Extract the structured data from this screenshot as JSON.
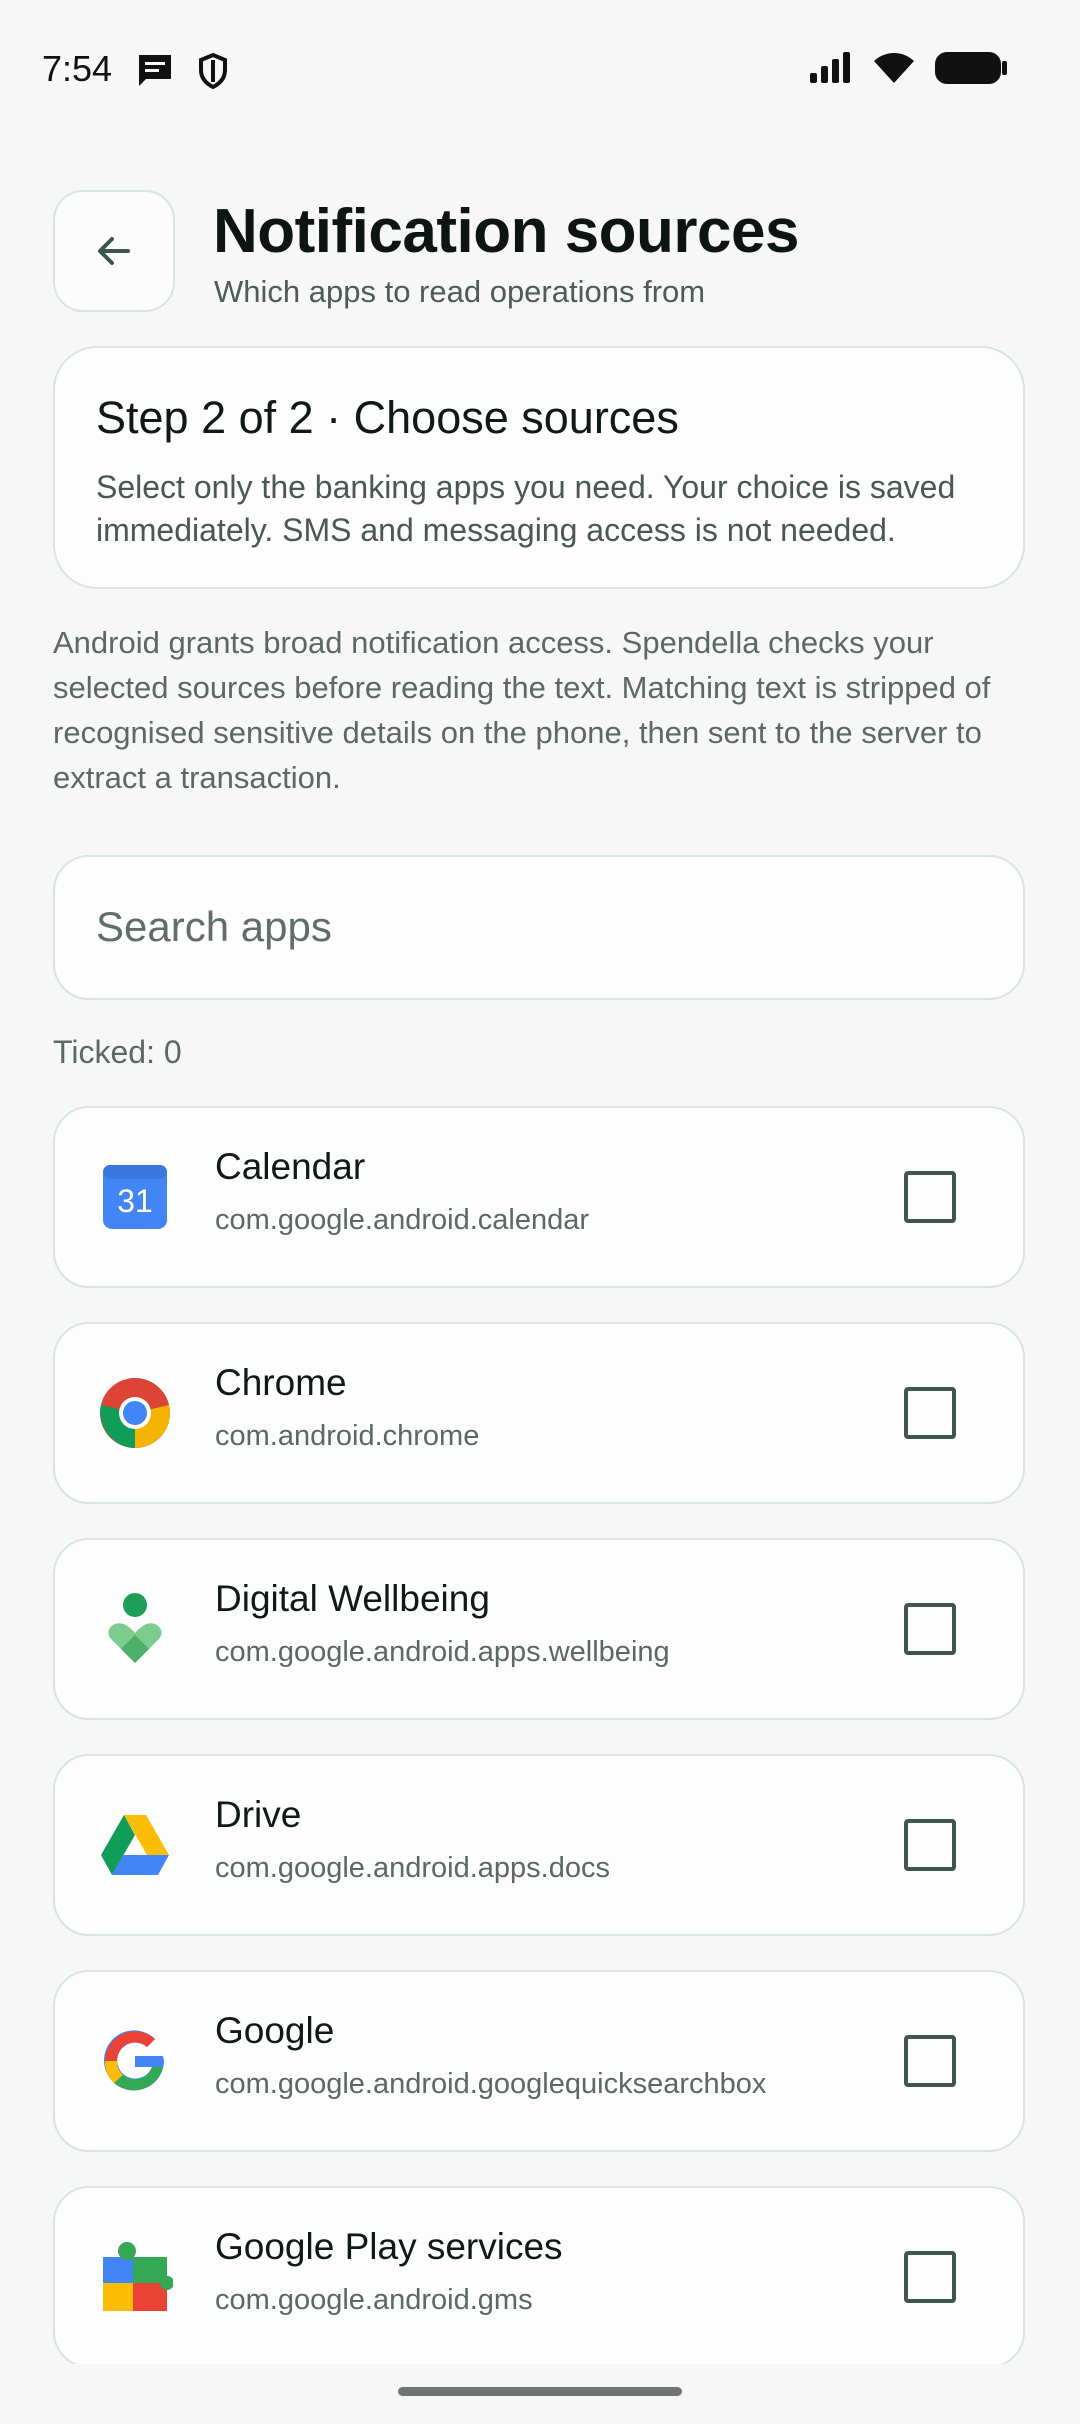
{
  "status_bar": {
    "time": "7:54",
    "icons": [
      "message-icon",
      "shield-icon",
      "signal-icon",
      "wifi-icon",
      "battery-icon"
    ]
  },
  "header": {
    "title": "Notification sources",
    "subtitle": "Which apps to read operations from",
    "back_icon": "arrow-left-icon"
  },
  "step_card": {
    "title": "Step 2 of 2 · Choose sources",
    "description": "Select only the banking apps you need. Your choice is saved immediately. SMS and messaging access is not needed."
  },
  "info_text": "Android grants broad notification access. Spendella checks your selected sources before reading the text. Matching text is stripped of recognised sensitive details on the phone, then sent to the server to extract a transaction.",
  "search": {
    "placeholder": "Search apps"
  },
  "ticked_label": "Ticked: 0",
  "apps": [
    {
      "name": "Calendar",
      "package": "com.google.android.calendar",
      "icon": "calendar-icon",
      "checked": false
    },
    {
      "name": "Chrome",
      "package": "com.android.chrome",
      "icon": "chrome-icon",
      "checked": false
    },
    {
      "name": "Digital Wellbeing",
      "package": "com.google.android.apps.wellbeing",
      "icon": "wellbeing-icon",
      "checked": false
    },
    {
      "name": "Drive",
      "package": "com.google.android.apps.docs",
      "icon": "drive-icon",
      "checked": false
    },
    {
      "name": "Google",
      "package": "com.google.android.googlequicksearchbox",
      "icon": "google-icon",
      "checked": false
    },
    {
      "name": "Google Play services",
      "package": "com.google.android.gms",
      "icon": "play-services-icon",
      "checked": false
    }
  ],
  "calendar_icon_day": "31",
  "colors": {
    "accent": "#3e564b",
    "border": "#d7e6df",
    "background": "#f6f7f6"
  }
}
